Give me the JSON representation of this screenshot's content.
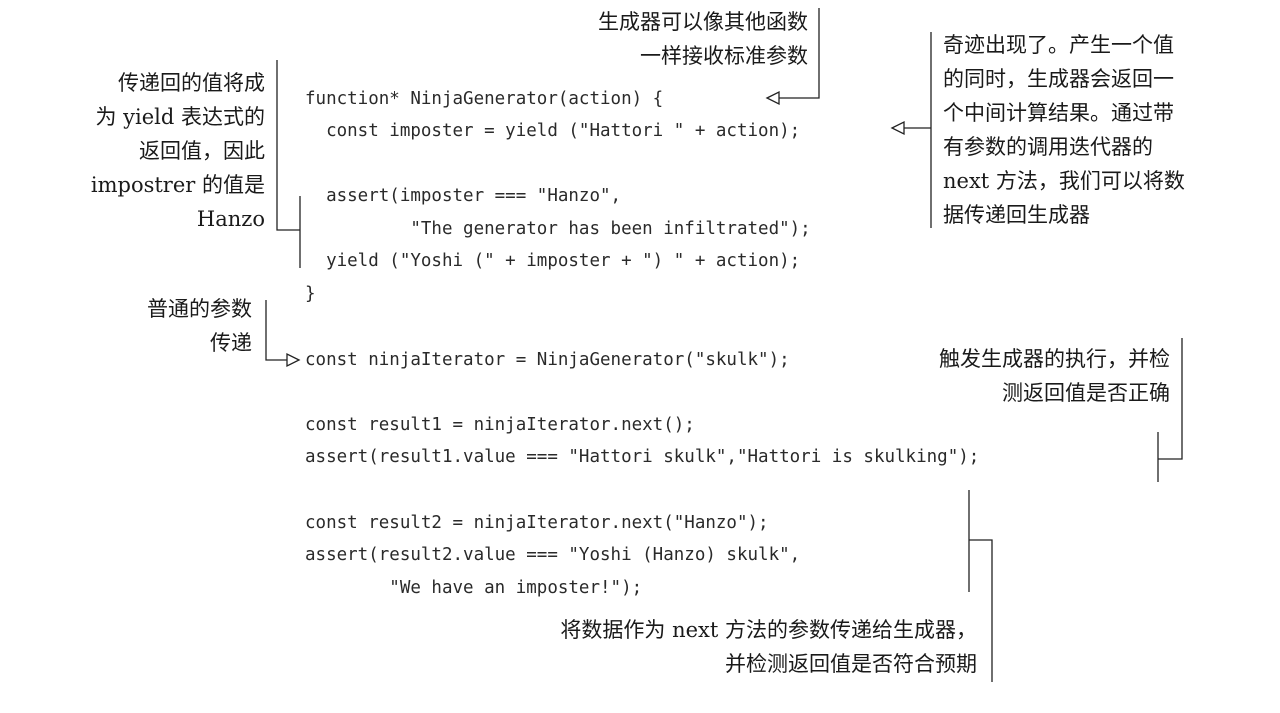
{
  "code": [
    "function* NinjaGenerator(action) {",
    "  const imposter = yield (\"Hattori \" + action);",
    "",
    "  assert(imposter === \"Hanzo\",",
    "          \"The generator has been infiltrated\");",
    "  yield (\"Yoshi (\" + imposter + \") \" + action);",
    "}",
    "",
    "const ninjaIterator = NinjaGenerator(\"skulk\");",
    "",
    "const result1 = ninjaIterator.next();",
    "assert(result1.value === \"Hattori skulk\",\"Hattori is skulking\");",
    "",
    "const result2 = ninjaIterator.next(\"Hanzo\");",
    "assert(result2.value === \"Yoshi (Hanzo) skulk\",",
    "        \"We have an imposter!\");"
  ],
  "annotations": {
    "params": [
      "生成器可以像其他函数",
      "一样接收标准参数"
    ],
    "magic": [
      "奇迹出现了。产生一个值",
      "的同时，生成器会返回一",
      "个中间计算结果。通过带",
      "有参数的调用迭代器的",
      "next 方法，我们可以将数",
      "据传递回生成器"
    ],
    "yield_value": [
      "传递回的值将成",
      "为 yield 表达式的",
      "返回值，因此",
      "impostrer 的值是",
      "Hanzo"
    ],
    "normal_params": [
      "普通的参数",
      "传递"
    ],
    "trigger": [
      "触发生成器的执行，并检",
      "测返回值是否正确"
    ],
    "pass_data": [
      "将数据作为 next 方法的参数传递给生成器，",
      "并检测返回值是否符合预期"
    ]
  }
}
